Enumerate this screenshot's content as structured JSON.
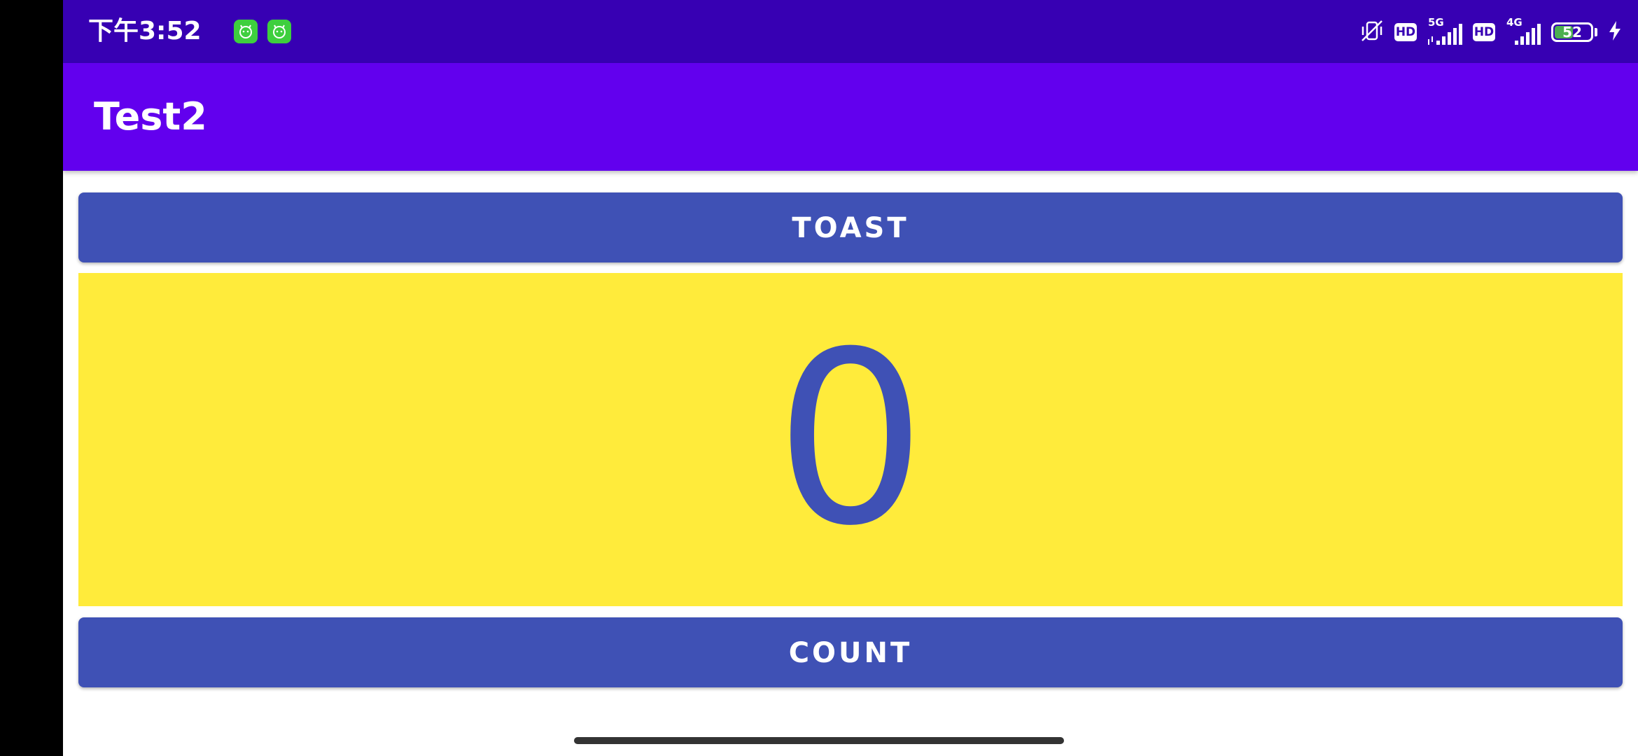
{
  "status_bar": {
    "time": "下午3:52",
    "notification_icons": [
      "app-notification-icon",
      "app-notification-icon"
    ],
    "icons": [
      "vibrate-off-icon",
      "hd-icon",
      "signal-5g-icon",
      "hd-icon",
      "signal-4g-icon",
      "battery-icon",
      "charging-icon"
    ],
    "hd_label": "HD",
    "network_1": "5G",
    "network_2": "4G",
    "battery_level": "52",
    "battery_fraction": 0.52
  },
  "app_bar": {
    "title": "Test2"
  },
  "toast_button": {
    "label": "TOAST"
  },
  "count_display": {
    "value": "0"
  },
  "count_button": {
    "label": "COUNT"
  },
  "colors": {
    "status_bar": "#3700b3",
    "app_bar": "#6200ee",
    "button": "#3f51b5",
    "count_panel": "#ffeb3b",
    "count_text": "#3f51b5"
  }
}
